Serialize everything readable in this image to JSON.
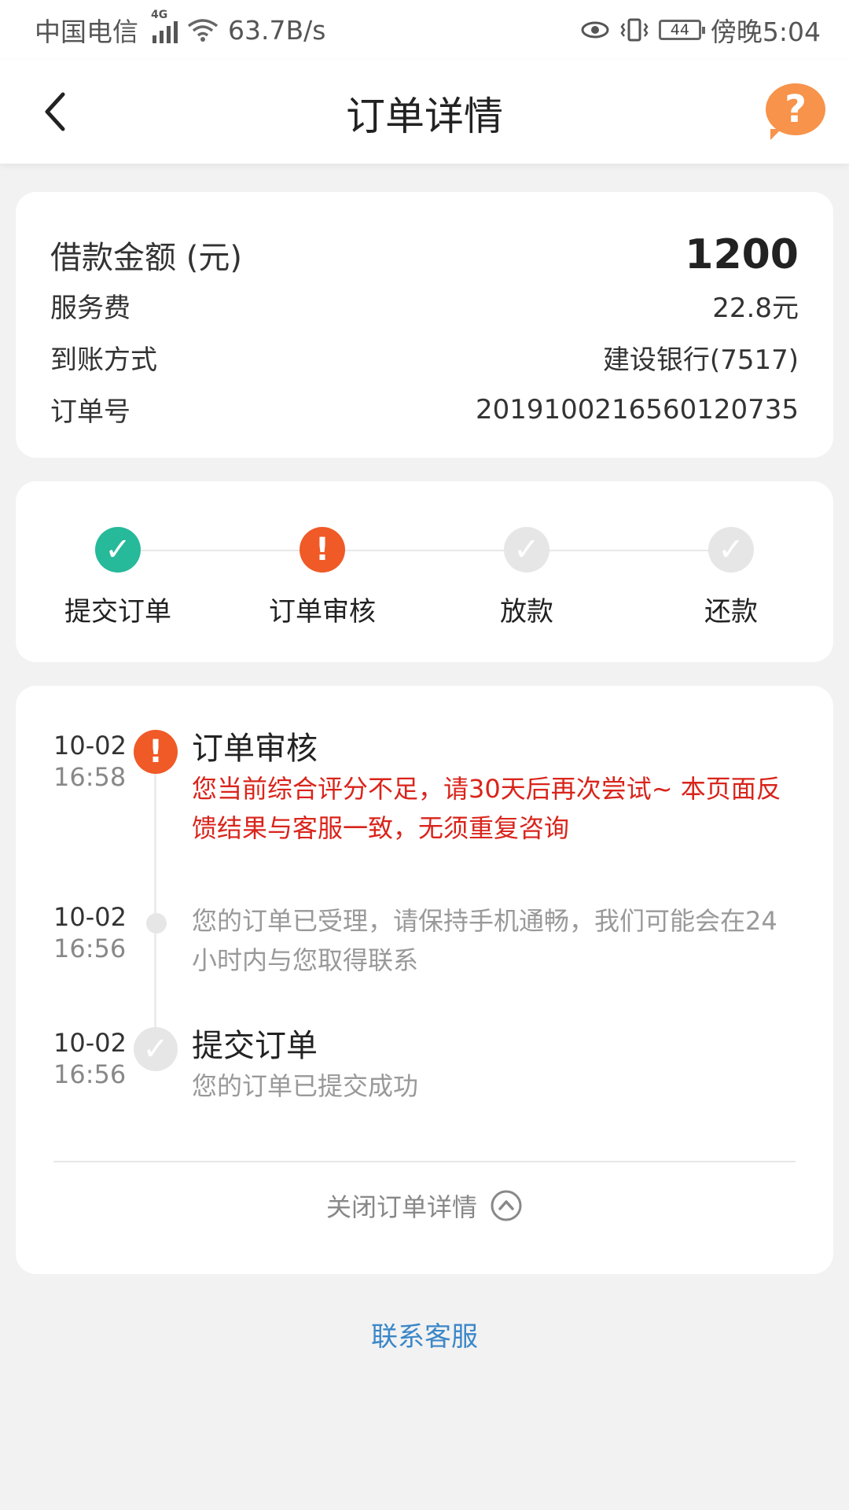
{
  "status_bar": {
    "carrier": "中国电信",
    "network_tag": "4G",
    "speed": "63.7B/s",
    "battery": "44",
    "time": "傍晚5:04"
  },
  "nav": {
    "title": "订单详情",
    "help_symbol": "?"
  },
  "summary": {
    "amount_label": "借款金额 (元)",
    "amount_value": "1200",
    "fee_label": "服务费",
    "fee_value": "22.8元",
    "method_label": "到账方式",
    "method_value": "建设银行(7517)",
    "order_label": "订单号",
    "order_value": "20191002165601207 35"
  },
  "steps": [
    {
      "label": "提交订单",
      "state": "done"
    },
    {
      "label": "订单审核",
      "state": "warn"
    },
    {
      "label": "放款",
      "state": "todo"
    },
    {
      "label": "还款",
      "state": "todo"
    }
  ],
  "timeline": [
    {
      "date": "10-02",
      "time": "16:58",
      "title": "订单审核",
      "desc": "您当前综合评分不足，请30天后再次尝试~ 本页面反馈结果与客服一致，无须重复咨询"
    },
    {
      "date": "10-02",
      "time": "16:56",
      "title": "",
      "desc": "您的订单已受理，请保持手机通畅，我们可能会在24小时内与您取得联系"
    },
    {
      "date": "10-02",
      "time": "16:56",
      "title": "提交订单",
      "desc": "您的订单已提交成功"
    }
  ],
  "close_label": "关闭订单详情",
  "contact_label": "联系客服",
  "colors": {
    "accent_orange": "#ef5a27",
    "success_green": "#26b99a",
    "link_blue": "#3b87c8",
    "warning_red": "#d9241b"
  }
}
